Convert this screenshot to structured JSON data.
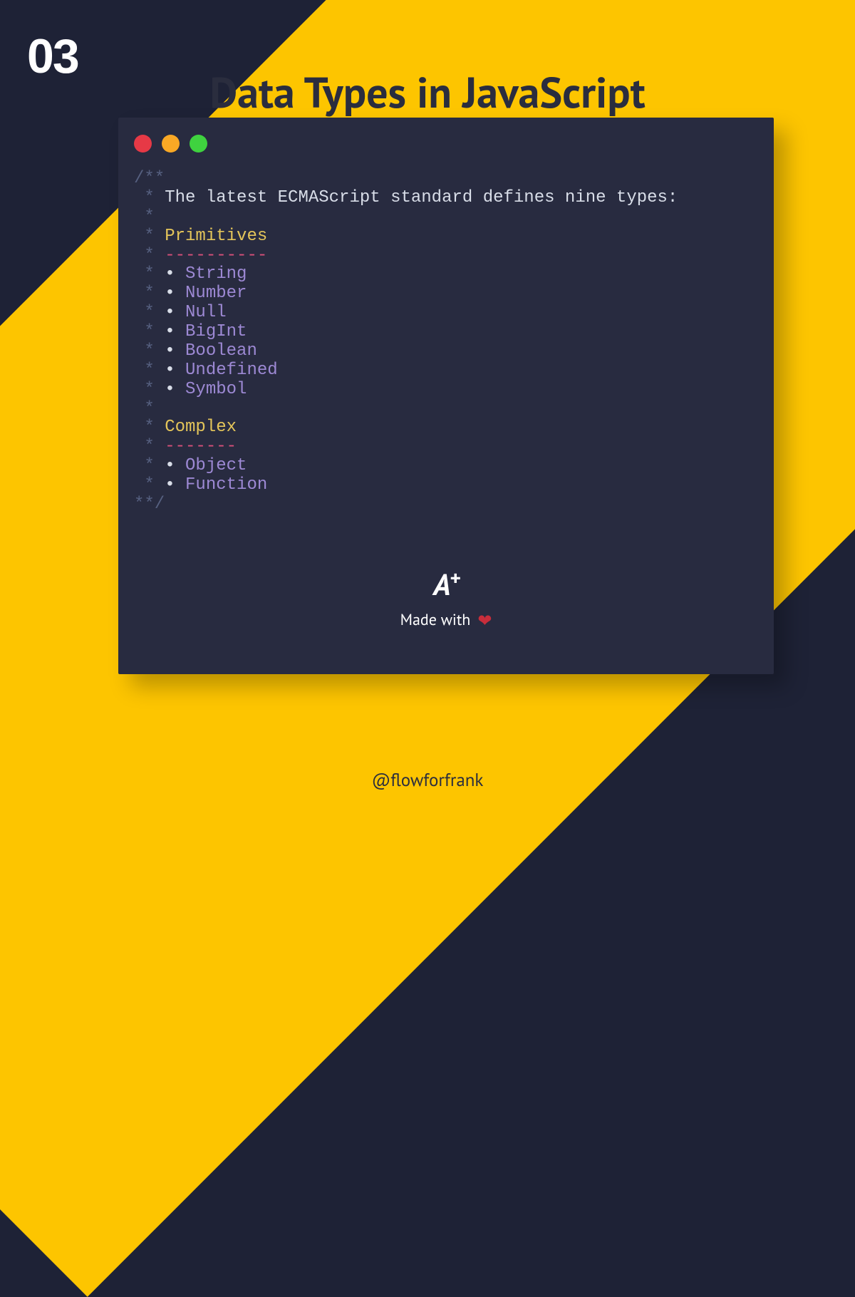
{
  "slideNumber": "03",
  "title": "Data Types in JavaScript",
  "comment": {
    "open": "/**",
    "star": " *",
    "intro": "The latest ECMAScript standard defines nine types:",
    "section1": "Primitives",
    "underline1": "----------",
    "section2": "Complex",
    "underline2": "-------",
    "bullet": "•",
    "primitives": [
      "String",
      "Number",
      "Null",
      "BigInt",
      "Boolean",
      "Undefined",
      "Symbol"
    ],
    "complex": [
      "Object",
      "Function"
    ],
    "close": "**/"
  },
  "logo": "A+",
  "madeWith": "Made with",
  "handle": "@flowforfrank"
}
